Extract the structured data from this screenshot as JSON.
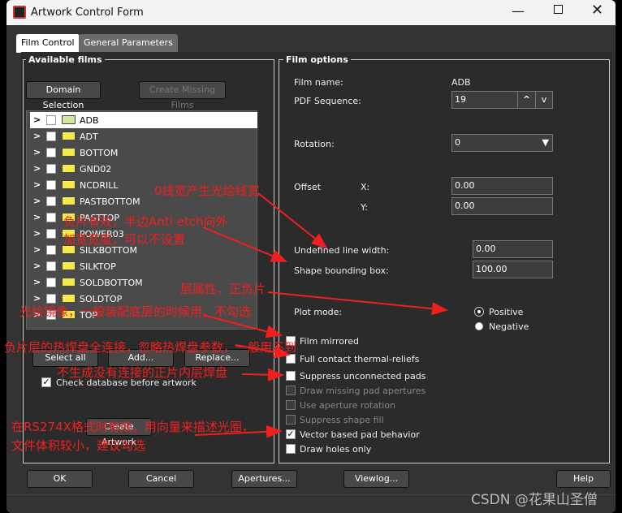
{
  "window": {
    "title": "Artwork Control Form"
  },
  "tabs": [
    {
      "label": "Film Control",
      "active": true
    },
    {
      "label": "General Parameters",
      "active": false
    }
  ],
  "available_films": {
    "title": "Available films",
    "domain_selection": "Domain Selection",
    "create_missing": "Create Missing Films",
    "films": [
      "ADB",
      "ADT",
      "BOTTOM",
      "GND02",
      "NCDRILL",
      "PASTBOTTOM",
      "PASTTOP",
      "POWER03",
      "SILKBOTTOM",
      "SILKTOP",
      "SOLDBOTTOM",
      "SOLDTOP",
      "TOP"
    ],
    "selected": "ADB",
    "select_all": "Select all",
    "add": "Add...",
    "replace": "Replace...",
    "check_db": "Check database before artwork",
    "check_db_checked": true,
    "create_artwork": "Create Artwork"
  },
  "film_options": {
    "title": "Film options",
    "film_name_label": "Film name:",
    "film_name": "ADB",
    "pdf_label": "PDF Sequence:",
    "pdf_value": "19",
    "rotation_label": "Rotation:",
    "rotation_value": "0",
    "offset_label": "Offset",
    "x_label": "X:",
    "x_value": "0.00",
    "y_label": "Y:",
    "y_value": "0.00",
    "ulw_label": "Undefined line width:",
    "ulw_value": "0.00",
    "sbb_label": "Shape bounding box:",
    "sbb_value": "100.00",
    "plot_mode_label": "Plot mode:",
    "positive": "Positive",
    "negative": "Negative",
    "plot_mode": "Positive",
    "options": [
      {
        "label": "Film mirrored",
        "checked": false,
        "enabled": true
      },
      {
        "label": "Full contact thermal-reliefs",
        "checked": false,
        "enabled": true
      },
      {
        "label": "Suppress unconnected pads",
        "checked": false,
        "enabled": true
      },
      {
        "label": "Draw missing pad apertures",
        "checked": false,
        "enabled": false
      },
      {
        "label": "Use aperture rotation",
        "checked": false,
        "enabled": false
      },
      {
        "label": "Suppress shape fill",
        "checked": false,
        "enabled": false
      },
      {
        "label": "Vector based pad behavior",
        "checked": true,
        "enabled": true
      },
      {
        "label": "Draw holes only",
        "checked": false,
        "enabled": true
      }
    ]
  },
  "footer": {
    "ok": "OK",
    "cancel": "Cancel",
    "apertures": "Apertures...",
    "viewlog": "Viewlog...",
    "help": "Help"
  },
  "annotations": {
    "a1": "0线宽产生光绘线宽",
    "a2a": "负片有效，半边Anti etch向外",
    "a2b": "加宽宽度，可以不设置",
    "a3": "层属性，正负片",
    "a4": "光绘镜像，一般装配底层的时候用，不勾选",
    "a5": "负片层的热焊盘全连接，忽略热焊盘参数，一般用不到",
    "a6": "不生成没有连接的正片内层焊盘",
    "a7a": "在RS274X格式时有效，用向量来描述光圈，",
    "a7b": "文件体积较小，建议勾选"
  },
  "watermark": "CSDN @花果山圣僧",
  "colors": {
    "annotation": "#f02020",
    "folder": "#f5e84a"
  }
}
